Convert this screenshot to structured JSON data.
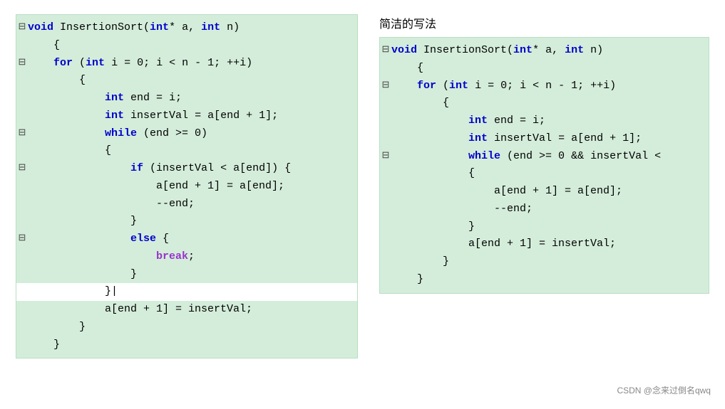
{
  "title": "简洁的写法",
  "watermark": "CSDN @念来过倒名qwq",
  "left_code": {
    "lines": [
      {
        "indent": 0,
        "fold": "minus",
        "content": [
          {
            "t": "kw",
            "v": "void"
          },
          {
            "t": "fn",
            "v": " InsertionSort("
          },
          {
            "t": "kw",
            "v": "int"
          },
          {
            "t": "fn",
            "v": "* a, "
          },
          {
            "t": "kw",
            "v": "int"
          },
          {
            "t": "fn",
            "v": " n)"
          }
        ]
      },
      {
        "indent": 0,
        "fold": null,
        "content": [
          {
            "t": "punct",
            "v": "    {"
          }
        ]
      },
      {
        "indent": 1,
        "fold": "minus",
        "content": [
          {
            "t": "fn",
            "v": "    "
          },
          {
            "t": "kw",
            "v": "for"
          },
          {
            "t": "fn",
            "v": " ("
          },
          {
            "t": "kw",
            "v": "int"
          },
          {
            "t": "fn",
            "v": " i = 0; i < n - 1; ++i)"
          }
        ]
      },
      {
        "indent": 1,
        "fold": null,
        "content": [
          {
            "t": "fn",
            "v": "        {"
          }
        ]
      },
      {
        "indent": 2,
        "fold": null,
        "content": [
          {
            "t": "fn",
            "v": "            "
          },
          {
            "t": "kw",
            "v": "int"
          },
          {
            "t": "fn",
            "v": " end = i;"
          }
        ]
      },
      {
        "indent": 2,
        "fold": null,
        "content": [
          {
            "t": "fn",
            "v": "            "
          },
          {
            "t": "kw",
            "v": "int"
          },
          {
            "t": "fn",
            "v": " insertVal = a[end + 1];"
          }
        ]
      },
      {
        "indent": 2,
        "fold": "minus",
        "content": [
          {
            "t": "fn",
            "v": "            "
          },
          {
            "t": "kw",
            "v": "while"
          },
          {
            "t": "fn",
            "v": " (end >= 0)"
          }
        ]
      },
      {
        "indent": 2,
        "fold": null,
        "content": [
          {
            "t": "fn",
            "v": "            {"
          }
        ]
      },
      {
        "indent": 3,
        "fold": "minus",
        "content": [
          {
            "t": "fn",
            "v": "                "
          },
          {
            "t": "kw",
            "v": "if"
          },
          {
            "t": "fn",
            "v": " (insertVal < a[end]) {"
          }
        ]
      },
      {
        "indent": 3,
        "fold": null,
        "content": [
          {
            "t": "fn",
            "v": "                    a[end + 1] = a[end];"
          }
        ]
      },
      {
        "indent": 3,
        "fold": null,
        "content": [
          {
            "t": "fn",
            "v": "                    --end;"
          }
        ]
      },
      {
        "indent": 3,
        "fold": null,
        "content": [
          {
            "t": "fn",
            "v": "                }"
          }
        ]
      },
      {
        "indent": 3,
        "fold": "minus",
        "content": [
          {
            "t": "fn",
            "v": "                "
          },
          {
            "t": "kw",
            "v": "else"
          },
          {
            "t": "fn",
            "v": " {"
          }
        ]
      },
      {
        "indent": 4,
        "fold": null,
        "content": [
          {
            "t": "fn",
            "v": "                    "
          },
          {
            "t": "kw-break",
            "v": "break"
          },
          {
            "t": "fn",
            "v": ";"
          }
        ]
      },
      {
        "indent": 3,
        "fold": null,
        "content": [
          {
            "t": "fn",
            "v": "                }"
          }
        ]
      },
      {
        "indent": 2,
        "fold": null,
        "content": [
          {
            "t": "fn",
            "v": "            }"
          },
          {
            "t": "fn",
            "v": "|"
          }
        ],
        "highlighted": true
      },
      {
        "indent": 2,
        "fold": null,
        "content": [
          {
            "t": "fn",
            "v": "            a[end + 1] = insertVal;"
          }
        ]
      },
      {
        "indent": 1,
        "fold": null,
        "content": [
          {
            "t": "fn",
            "v": "        }"
          }
        ]
      },
      {
        "indent": 0,
        "fold": null,
        "content": [
          {
            "t": "fn",
            "v": "    }"
          }
        ]
      }
    ]
  },
  "right_code": {
    "lines": [
      {
        "indent": 0,
        "fold": "minus",
        "content": [
          {
            "t": "kw",
            "v": "void"
          },
          {
            "t": "fn",
            "v": " InsertionSort("
          },
          {
            "t": "kw",
            "v": "int"
          },
          {
            "t": "fn",
            "v": "* a, "
          },
          {
            "t": "kw",
            "v": "int"
          },
          {
            "t": "fn",
            "v": " n)"
          }
        ]
      },
      {
        "indent": 0,
        "fold": null,
        "content": [
          {
            "t": "fn",
            "v": "    {"
          }
        ]
      },
      {
        "indent": 1,
        "fold": "minus",
        "content": [
          {
            "t": "fn",
            "v": "    "
          },
          {
            "t": "kw",
            "v": "for"
          },
          {
            "t": "fn",
            "v": " ("
          },
          {
            "t": "kw",
            "v": "int"
          },
          {
            "t": "fn",
            "v": " i = 0; i < n - 1; ++i)"
          }
        ]
      },
      {
        "indent": 1,
        "fold": null,
        "content": [
          {
            "t": "fn",
            "v": "        {"
          }
        ]
      },
      {
        "indent": 2,
        "fold": null,
        "content": [
          {
            "t": "fn",
            "v": "            "
          },
          {
            "t": "kw",
            "v": "int"
          },
          {
            "t": "fn",
            "v": " end = i;"
          }
        ]
      },
      {
        "indent": 2,
        "fold": null,
        "content": [
          {
            "t": "fn",
            "v": "            "
          },
          {
            "t": "kw",
            "v": "int"
          },
          {
            "t": "fn",
            "v": " insertVal = a[end + 1];"
          }
        ]
      },
      {
        "indent": 2,
        "fold": "minus",
        "content": [
          {
            "t": "fn",
            "v": "            "
          },
          {
            "t": "kw",
            "v": "while"
          },
          {
            "t": "fn",
            "v": " (end >= 0 && insertVal <"
          }
        ]
      },
      {
        "indent": 2,
        "fold": null,
        "content": [
          {
            "t": "fn",
            "v": "            {"
          }
        ]
      },
      {
        "indent": 3,
        "fold": null,
        "content": [
          {
            "t": "fn",
            "v": "                a[end + 1] = a[end];"
          }
        ]
      },
      {
        "indent": 3,
        "fold": null,
        "content": [
          {
            "t": "fn",
            "v": "                --end;"
          }
        ]
      },
      {
        "indent": 2,
        "fold": null,
        "content": [
          {
            "t": "fn",
            "v": "            }"
          }
        ]
      },
      {
        "indent": 2,
        "fold": null,
        "content": [
          {
            "t": "fn",
            "v": "            a[end + 1] = insertVal;"
          }
        ]
      },
      {
        "indent": 1,
        "fold": null,
        "content": [
          {
            "t": "fn",
            "v": "        }"
          }
        ]
      },
      {
        "indent": 0,
        "fold": null,
        "content": [
          {
            "t": "fn",
            "v": "    }"
          }
        ]
      }
    ]
  }
}
